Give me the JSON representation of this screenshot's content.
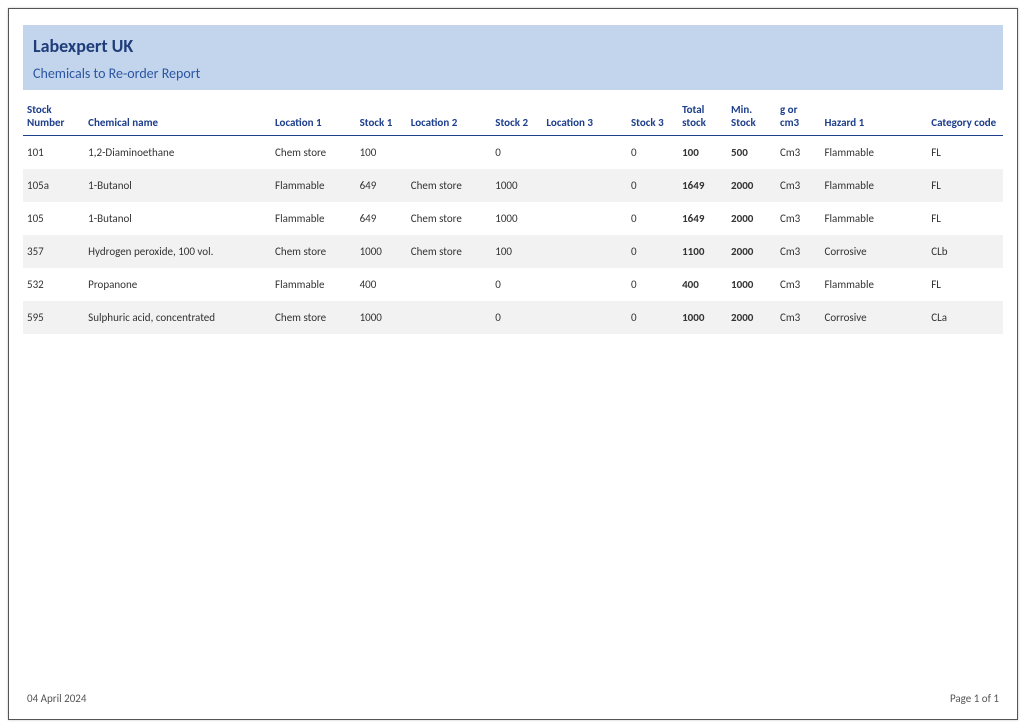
{
  "header": {
    "title": "Labexpert UK",
    "subtitle": "Chemicals to Re-order Report"
  },
  "columns": {
    "stock_number": "Stock Number",
    "chemical_name": "Chemical name",
    "location1": "Location 1",
    "stock1": "Stock 1",
    "location2": "Location 2",
    "stock2": "Stock 2",
    "location3": "Location 3",
    "stock3": "Stock 3",
    "total_stock": "Total stock",
    "min_stock": "Min. Stock",
    "unit": "g or cm3",
    "hazard1": "Hazard 1",
    "category": "Category code"
  },
  "rows": [
    {
      "stock_number": "101",
      "chemical_name": "1,2-Diaminoethane",
      "location1": "Chem store",
      "stock1": "100",
      "location2": "",
      "stock2": "0",
      "location3": "",
      "stock3": "0",
      "total_stock": "100",
      "min_stock": "500",
      "unit": "Cm3",
      "hazard1": "Flammable",
      "category": "FL"
    },
    {
      "stock_number": "105a",
      "chemical_name": "1-Butanol",
      "location1": "Flammable",
      "stock1": "649",
      "location2": "Chem store",
      "stock2": "1000",
      "location3": "",
      "stock3": "0",
      "total_stock": "1649",
      "min_stock": "2000",
      "unit": "Cm3",
      "hazard1": "Flammable",
      "category": "FL"
    },
    {
      "stock_number": "105",
      "chemical_name": "1-Butanol",
      "location1": "Flammable",
      "stock1": "649",
      "location2": "Chem store",
      "stock2": "1000",
      "location3": "",
      "stock3": "0",
      "total_stock": "1649",
      "min_stock": "2000",
      "unit": "Cm3",
      "hazard1": "Flammable",
      "category": "FL"
    },
    {
      "stock_number": "357",
      "chemical_name": "Hydrogen peroxide, 100 vol.",
      "location1": "Chem store",
      "stock1": "1000",
      "location2": "Chem store",
      "stock2": "100",
      "location3": "",
      "stock3": "0",
      "total_stock": "1100",
      "min_stock": "2000",
      "unit": "Cm3",
      "hazard1": "Corrosive",
      "category": "CLb"
    },
    {
      "stock_number": "532",
      "chemical_name": "Propanone",
      "location1": "Flammable",
      "stock1": "400",
      "location2": "",
      "stock2": "0",
      "location3": "",
      "stock3": "0",
      "total_stock": "400",
      "min_stock": "1000",
      "unit": "Cm3",
      "hazard1": "Flammable",
      "category": "FL"
    },
    {
      "stock_number": "595",
      "chemical_name": "Sulphuric acid, concentrated",
      "location1": "Chem store",
      "stock1": "1000",
      "location2": "",
      "stock2": "0",
      "location3": "",
      "stock3": "0",
      "total_stock": "1000",
      "min_stock": "2000",
      "unit": "Cm3",
      "hazard1": "Corrosive",
      "category": "CLa"
    }
  ],
  "footer": {
    "date": "04 April 2024",
    "page": "Page 1 of 1"
  }
}
